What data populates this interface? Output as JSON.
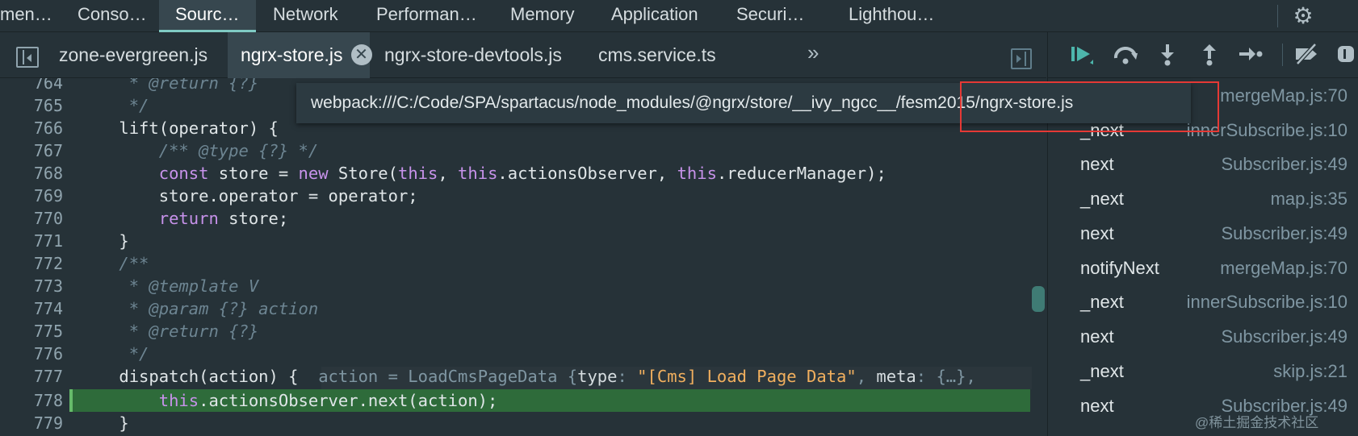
{
  "top_tabs": [
    "men…",
    "Conso…",
    "Sourc…",
    "Network",
    "Performan…",
    "Memory",
    "Application",
    "Securi…",
    "Lighthou…"
  ],
  "file_tabs": [
    "zone-evergreen.js",
    "ngrx-store.js",
    "ngrx-store-devtools.js",
    "cms.service.ts"
  ],
  "more_tabs_glyph": "»",
  "close_glyph": "✕",
  "tooltip_path": "webpack:///C:/Code/SPA/spartacus/node_modules/@ngrx/store/__ivy_ngcc__/fesm2015/ngrx-store.js",
  "highlight_color": "#e53935",
  "code": {
    "l764": {
      "no": "764",
      "comment": "     * @return {?}"
    },
    "l765": {
      "no": "765",
      "comment": "     */"
    },
    "l766": {
      "no": "766",
      "text": "    lift(operator) {"
    },
    "l767": {
      "no": "767",
      "comment": "        /** @type {?} */"
    },
    "l768": {
      "no": "768",
      "kw1": "        const",
      "t1": " store = ",
      "kw2": "new",
      "t2": " Store(",
      "kw3": "this",
      "t3": ", ",
      "kw4": "this",
      "t4": ".actionsObserver, ",
      "kw5": "this",
      "t5": ".reducerManager);"
    },
    "l769": {
      "no": "769",
      "text": "        store.operator = operator;"
    },
    "l770": {
      "no": "770",
      "kw": "        return",
      "text": " store;"
    },
    "l771": {
      "no": "771",
      "text": "    }"
    },
    "l772": {
      "no": "772",
      "comment": "    /**"
    },
    "l773": {
      "no": "773",
      "comment": "     * @template V"
    },
    "l774": {
      "no": "774",
      "comment": "     * @param {?} action"
    },
    "l775": {
      "no": "775",
      "comment": "     * @return {?}"
    },
    "l776": {
      "no": "776",
      "comment": "     */"
    },
    "l777": {
      "no": "777",
      "text": "    dispatch(action) {",
      "inline_a": "  action = LoadCmsPageData {",
      "inline_k1": "type",
      "inline_b": ": ",
      "inline_str": "\"[Cms] Load Page Data\"",
      "inline_c": ", ",
      "inline_k2": "meta",
      "inline_d": ": {…},"
    },
    "l778": {
      "no": "778",
      "kw": "        this",
      "text": ".actionsObserver.next(action);"
    },
    "l779": {
      "no": "779",
      "text": "    }"
    }
  },
  "call_stack": [
    {
      "name": "",
      "loc": "mergeMap.js:70"
    },
    {
      "name": "_next",
      "loc": "innerSubscribe.js:10"
    },
    {
      "name": "next",
      "loc": "Subscriber.js:49"
    },
    {
      "name": "_next",
      "loc": "map.js:35"
    },
    {
      "name": "next",
      "loc": "Subscriber.js:49"
    },
    {
      "name": "notifyNext",
      "loc": "mergeMap.js:70"
    },
    {
      "name": "_next",
      "loc": "innerSubscribe.js:10"
    },
    {
      "name": "next",
      "loc": "Subscriber.js:49"
    },
    {
      "name": "_next",
      "loc": "skip.js:21"
    },
    {
      "name": "next",
      "loc": "Subscriber.js:49"
    }
  ],
  "watermark": "@稀土掘金技术社区",
  "icons": {
    "settings": "gear-icon",
    "resume": "resume-icon",
    "step_over": "step-over-icon",
    "step_into": "step-into-icon",
    "step_out": "step-out-icon",
    "step": "step-icon",
    "deactivate_breakpoints": "deactivate-breakpoints-icon",
    "pause_exceptions": "pause-on-exceptions-icon"
  }
}
